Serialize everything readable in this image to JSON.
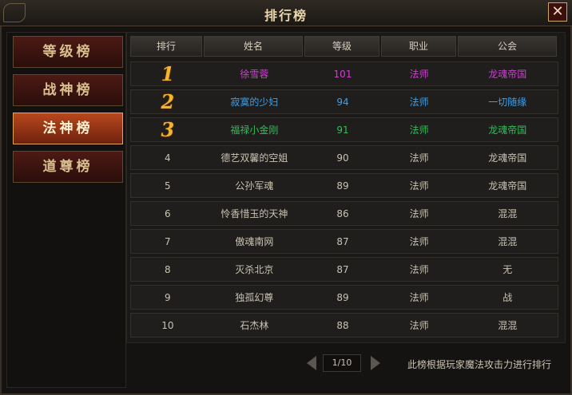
{
  "window": {
    "title": "排行榜",
    "close_label": "✕"
  },
  "sidebar": {
    "items": [
      {
        "label": "等级榜",
        "active": false
      },
      {
        "label": "战神榜",
        "active": false
      },
      {
        "label": "法神榜",
        "active": true
      },
      {
        "label": "道尊榜",
        "active": false
      }
    ]
  },
  "table": {
    "headers": [
      "排行",
      "姓名",
      "等级",
      "职业",
      "公会"
    ],
    "rows": [
      {
        "rank": "1",
        "name": "徐雪蓉",
        "level": "101",
        "job": "法师",
        "guild": "龙魂帝国",
        "color": "#d33bd6"
      },
      {
        "rank": "2",
        "name": "寂寞的少妇",
        "level": "94",
        "job": "法师",
        "guild": "一切随缘",
        "color": "#3e9fe8"
      },
      {
        "rank": "3",
        "name": "福禄小金刚",
        "level": "91",
        "job": "法师",
        "guild": "龙魂帝国",
        "color": "#2fbf57"
      },
      {
        "rank": "4",
        "name": "德艺双馨的空姐",
        "level": "90",
        "job": "法师",
        "guild": "龙魂帝国",
        "color": "#c9c2b3"
      },
      {
        "rank": "5",
        "name": "公孙军魂",
        "level": "89",
        "job": "法师",
        "guild": "龙魂帝国",
        "color": "#c9c2b3"
      },
      {
        "rank": "6",
        "name": "怜香惜玉的天神",
        "level": "86",
        "job": "法师",
        "guild": "混混",
        "color": "#c9c2b3"
      },
      {
        "rank": "7",
        "name": "傲魂南网",
        "level": "87",
        "job": "法师",
        "guild": "混混",
        "color": "#c9c2b3"
      },
      {
        "rank": "8",
        "name": "灭杀北京",
        "level": "87",
        "job": "法师",
        "guild": "无",
        "color": "#c9c2b3"
      },
      {
        "rank": "9",
        "name": "独孤幻尊",
        "level": "89",
        "job": "法师",
        "guild": "战",
        "color": "#c9c2b3"
      },
      {
        "rank": "10",
        "name": "石杰林",
        "level": "88",
        "job": "法师",
        "guild": "混混",
        "color": "#c9c2b3"
      }
    ]
  },
  "footer": {
    "page": "1/10",
    "note": "此榜根据玩家魔法攻击力进行排行"
  }
}
